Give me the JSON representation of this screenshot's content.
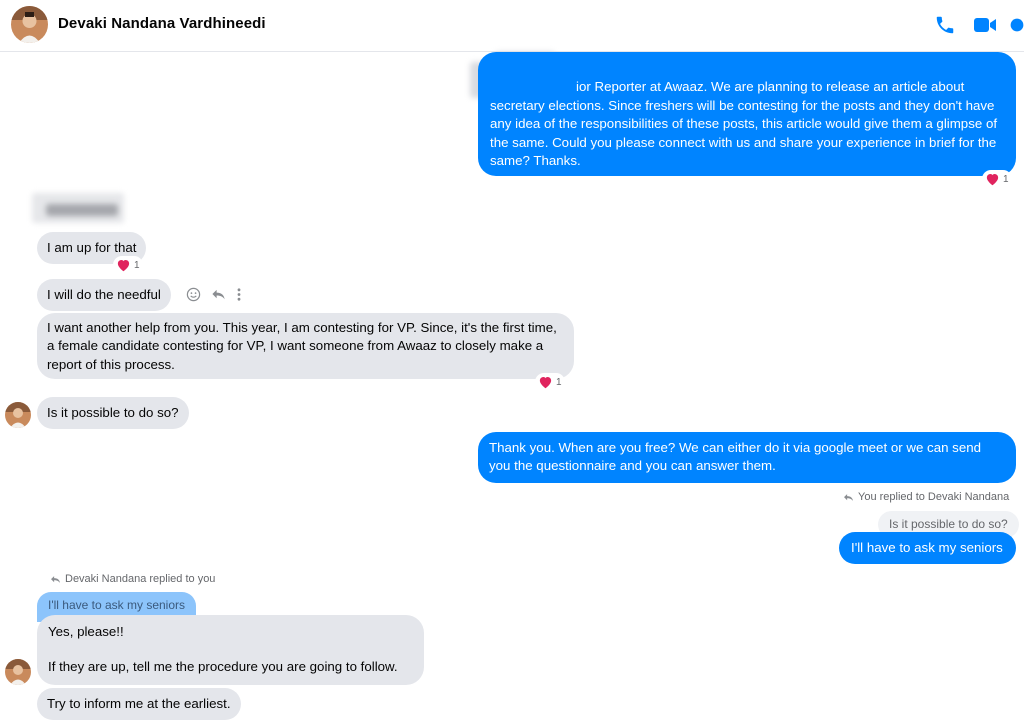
{
  "header": {
    "contact_name": "Devaki Nandana Vardhineedi",
    "call_icon": "phone-icon",
    "video_icon": "video-camera-icon",
    "accent_color": "#0084ff"
  },
  "messages": {
    "m1": "ior Reporter at Awaaz. We are planning to release an article about secretary elections. Since freshers will be contesting for the posts and they don't have any idea of the responsibilities of these posts, this article would give them a glimpse of the same. Could you please connect with us and share your experience in brief for the same? Thanks.",
    "m1_reaction_count": "1",
    "m2": "I am up for that",
    "m2_reaction_count": "1",
    "m3": "I will do the needful",
    "m4": "I want another help from you. This year, I am contesting for VP. Since, it's the first time, a female candidate contesting for VP, I want someone from Awaaz to closely make a report of this process.",
    "m4_reaction_count": "1",
    "m5": "Is it possible to do so?",
    "m6": "Thank you. When are you free? We can either do it via google meet or we can send you the questionnaire and you can answer them.",
    "m7_reply_note": "You replied to Devaki Nandana",
    "m7_quote": "Is it possible to do so?",
    "m7": "I'll have to ask my seniors",
    "m8_reply_note": "Devaki Nandana replied to you",
    "m8_quote": "I'll have to ask my seniors",
    "m8_line1": "Yes, please!!",
    "m8_line2": "If they are up, tell me the procedure you are going to follow.",
    "m9": "Try to inform me at the earliest."
  },
  "icons": {
    "reaction": "heart-icon",
    "react_button": "smiley-icon",
    "reply_button": "reply-arrow-icon",
    "more_button": "vertical-dots-icon"
  }
}
